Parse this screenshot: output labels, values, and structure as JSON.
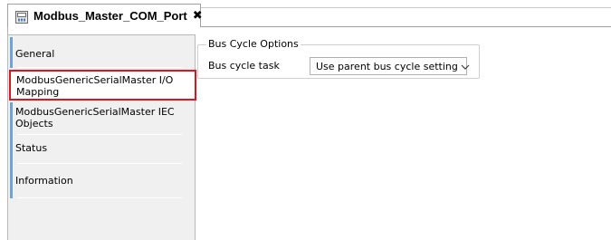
{
  "tab": {
    "title": "Modbus_Master_COM_Port",
    "close_glyph": "✖",
    "icon": "device-icon"
  },
  "sidebar": {
    "items": [
      {
        "label": "General"
      },
      {
        "label": "ModbusGenericSerialMaster I/O Mapping"
      },
      {
        "label": "ModbusGenericSerialMaster IEC Objects"
      },
      {
        "label": "Status"
      },
      {
        "label": "Information"
      }
    ],
    "selected_index": 1
  },
  "bus_cycle": {
    "group_title": "Bus Cycle Options",
    "task_label": "Bus cycle task",
    "task_value": "Use parent bus cycle setting"
  },
  "colors": {
    "selection_border": "#e0141e",
    "sidebar_accent": "#6ea3d8",
    "sidebar_bg": "#f0f0f0"
  }
}
